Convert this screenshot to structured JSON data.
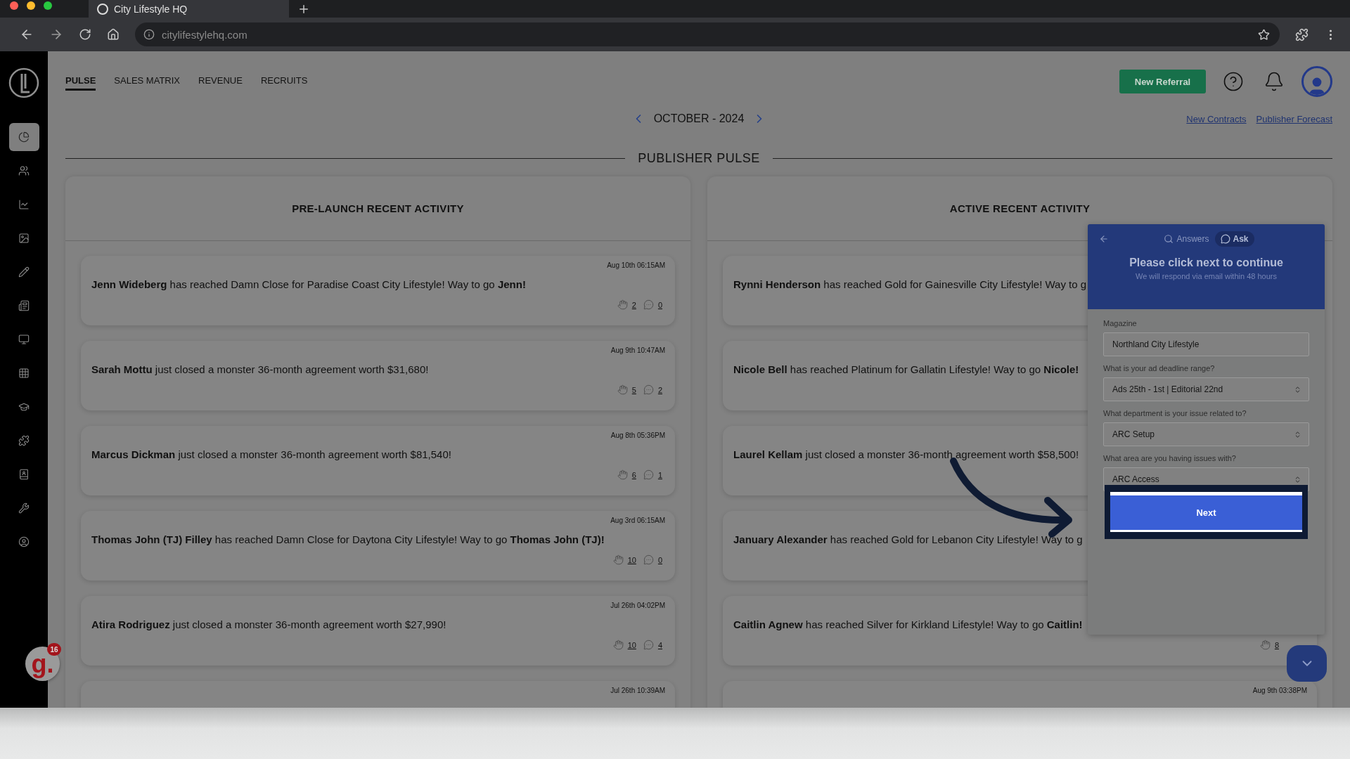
{
  "browser": {
    "tab_title": "City Lifestyle HQ",
    "url": "citylifestylehq.com"
  },
  "sidebar": {
    "items": [
      {
        "selected": true
      },
      {
        "selected": false
      },
      {
        "selected": false
      },
      {
        "selected": false
      },
      {
        "selected": false
      },
      {
        "selected": false
      },
      {
        "selected": false
      },
      {
        "selected": false
      },
      {
        "selected": false
      },
      {
        "selected": false
      },
      {
        "selected": false
      },
      {
        "selected": false
      },
      {
        "selected": false
      }
    ]
  },
  "nav": {
    "tabs": [
      {
        "label": "PULSE",
        "selected": true
      },
      {
        "label": "SALES MATRIX",
        "selected": false
      },
      {
        "label": "REVENUE",
        "selected": false
      },
      {
        "label": "RECRUITS",
        "selected": false
      }
    ],
    "new_referral": "New Referral"
  },
  "period": "OCTOBER - 2024",
  "links": [
    "New Contracts",
    "Publisher Forecast"
  ],
  "section_title": "PUBLISHER PULSE",
  "columns": [
    {
      "title": "PRE-LAUNCH RECENT ACTIVITY",
      "cards": [
        {
          "time": "Aug 10th 06:15AM",
          "message": "**Jenn Wideberg** has reached Damn Close for Paradise Coast City Lifestyle! Way to go **Jenn!**",
          "likes": "2",
          "comments": "0"
        },
        {
          "time": "Aug 9th 10:47AM",
          "message": "**Sarah Mottu** just closed a monster 36-month agreement worth $31,680!",
          "likes": "5",
          "comments": "2"
        },
        {
          "time": "Aug 8th 05:36PM",
          "message": "**Marcus Dickman** just closed a monster 36-month agreement worth $81,540!",
          "likes": "6",
          "comments": "1"
        },
        {
          "time": "Aug 3rd 06:15AM",
          "message": "**Thomas John (TJ) Filley** has reached Damn Close for Daytona City Lifestyle! Way to go **Thomas John (TJ)!**",
          "likes": "10",
          "comments": "0"
        },
        {
          "time": "Jul 26th 04:02PM",
          "message": "**Atira Rodriguez** just closed a monster 36-month agreement worth $27,990!",
          "likes": "10",
          "comments": "4"
        },
        {
          "time": "Jul 26th 10:39AM"
        }
      ]
    },
    {
      "title": "ACTIVE RECENT ACTIVITY",
      "cards": [
        {
          "message": "**Rynni Henderson** has reached Gold for Gainesville City Lifestyle! Way to g"
        },
        {
          "message": "**Nicole Bell** has reached Platinum for Gallatin Lifestyle! Way to go **Nicole!**"
        },
        {
          "message": "**Laurel Kellam** just closed a monster 36-month agreement worth $58,500!"
        },
        {
          "message": "**January Alexander** has reached Gold for Lebanon City Lifestyle! Way to g"
        },
        {
          "message": "**Caitlin Agnew** has reached Silver for Kirkland Lifestyle! Way to go **Caitlin!**",
          "likes": "8"
        },
        {
          "time": "Aug 9th 03:38PM"
        }
      ]
    }
  ],
  "help_widget": {
    "tabs": [
      {
        "label": "Answers",
        "selected": false
      },
      {
        "label": "Ask",
        "selected": true
      }
    ],
    "title": "Please click next to continue",
    "subtitle": "We will respond via email within 48 hours",
    "fields": [
      {
        "label": "Magazine",
        "kind": "text",
        "value": "Northland City Lifestyle"
      },
      {
        "label": "What is your ad deadline range?",
        "kind": "select",
        "value": "Ads 25th - 1st | Editorial 22nd"
      },
      {
        "label": "What department is your issue related to?",
        "kind": "select",
        "value": "ARC Setup"
      },
      {
        "label": "What area are you having issues with?",
        "kind": "select",
        "value": "ARC Access"
      }
    ],
    "submit": "Next"
  },
  "grammar_badge": {
    "letter": "g.",
    "count": "16"
  }
}
